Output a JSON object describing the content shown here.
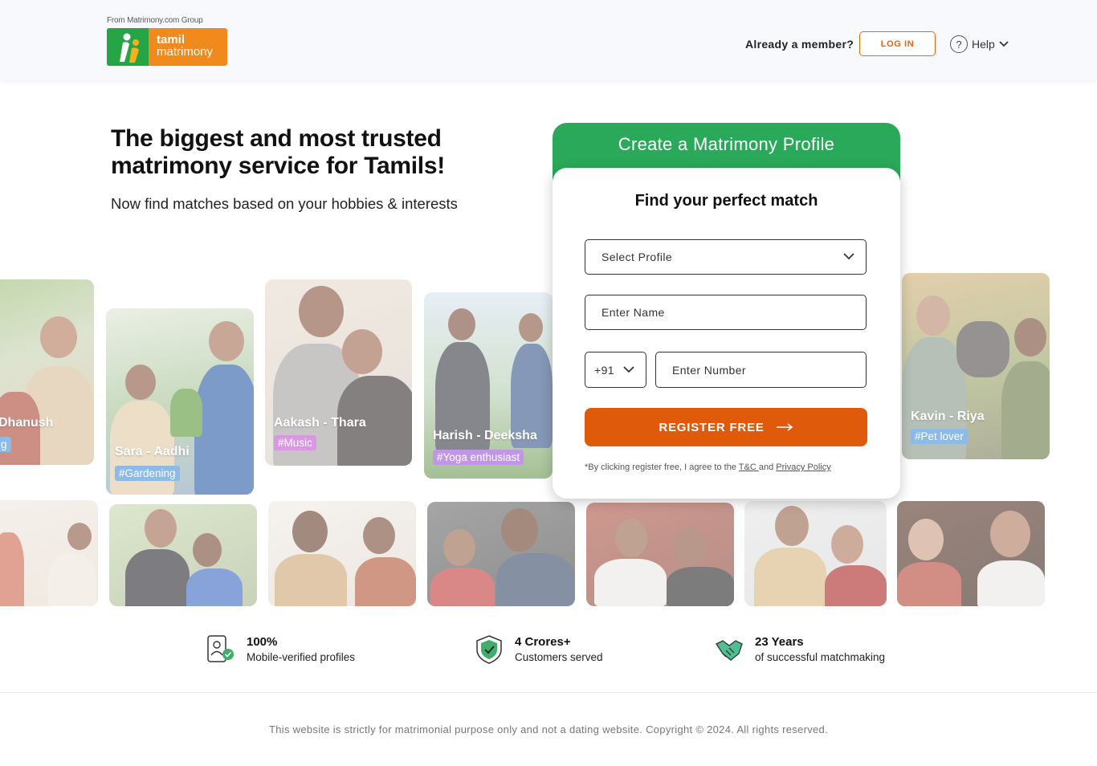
{
  "header": {
    "from_group": "From Matrimony.com Group",
    "logo_line1": "tamil",
    "logo_line2": "matrimony",
    "already_member": "Already a member?",
    "login_label": "LOG IN",
    "help_label": "Help",
    "help_glyph": "?"
  },
  "hero": {
    "title": "The biggest and most trusted matrimony service for Tamils!",
    "subtitle": "Now find matches based on your hobbies & interests"
  },
  "cards": [
    {
      "names": "Dhanush",
      "tag": "g",
      "tag_color": "#4a90d9"
    },
    {
      "names": "Sara - Aadhi",
      "tag": "#Gardening",
      "tag_color": "#4a90d9"
    },
    {
      "names": "Aakash - Thara",
      "tag": "#Music",
      "tag_color": "#c45ad1"
    },
    {
      "names": "Harish - Deeksha",
      "tag": "#Yoga enthusiast",
      "tag_color": "#9b59d9"
    },
    {
      "names": "Kavin - Riya",
      "tag": "#Pet lover",
      "tag_color": "#4a90d9"
    }
  ],
  "form": {
    "header": "Create a Matrimony Profile",
    "title": "Find your perfect match",
    "select_profile": "Select Profile",
    "name_placeholder": "Enter Name",
    "country_code": "+91",
    "number_placeholder": "Enter Number",
    "register_label": "REGISTER FREE",
    "terms_prefix": "*By clicking register free, I agree to the ",
    "terms_link": "T&C ",
    "terms_and": "and ",
    "privacy_link": "Privacy Policy"
  },
  "stats": [
    {
      "number": "100%",
      "text": "Mobile-verified profiles",
      "icon": "verified-profile-icon"
    },
    {
      "number": "4 Crores+",
      "text": "Customers served",
      "icon": "shield-check-icon"
    },
    {
      "number": "23 Years",
      "text": "of successful matchmaking",
      "icon": "handshake-icon"
    }
  ],
  "footer": {
    "text": "This website is strictly for matrimonial purpose only and not a dating website. Copyright © 2024. All rights reserved."
  },
  "colors": {
    "brand_green": "#2ba95a",
    "brand_orange": "#e05a0c",
    "logo_orange": "#f08a1c",
    "logo_green": "#27a443"
  }
}
